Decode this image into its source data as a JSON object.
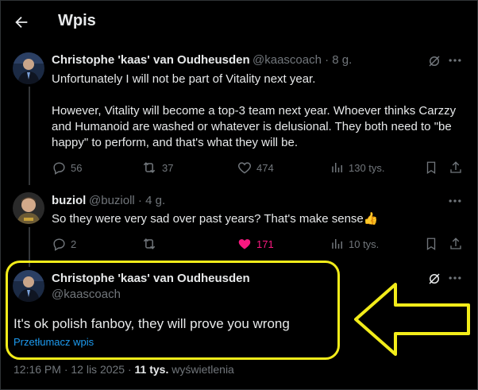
{
  "header": {
    "title": "Wpis",
    "back_icon": "back-arrow-icon"
  },
  "tweets": [
    {
      "author": "Christophe 'kaas' van Oudheusden",
      "handle": "@kaascoach",
      "time": "8 g.",
      "paragraphs": [
        "Unfortunately I will not be part of Vitality next year.",
        "However, Vitality will become a top-3 team next year. Whoever thinks Carzzy and Humanoid are washed or whatever is delusional. They both need to \"be happy\" to perform, and that's what they will be."
      ],
      "stats": {
        "replies": "56",
        "reposts": "37",
        "likes": "474",
        "views": "130 tys."
      }
    },
    {
      "author": "buziol",
      "handle": "@buzioll",
      "time": "4 g.",
      "text": "So they were very sad over past years? That's make sense",
      "emoji": "👍",
      "stats": {
        "replies": "2",
        "reposts": "",
        "likes": "171",
        "views": "10 tys."
      },
      "liked": true
    },
    {
      "author": "Christophe 'kaas' van Oudheusden",
      "handle": "@kaascoach",
      "text": "It's ok polish fanboy, they will prove you wrong",
      "translate": "Przetłumacz wpis",
      "time_full": "12:16 PM · 12 lis 2025 · ",
      "views_count": "11 tys.",
      "views_label": " wyświetlenia"
    }
  ],
  "colors": {
    "background": "#000000",
    "text": "#e7e9ea",
    "muted": "#71767b",
    "link": "#1d9bf0",
    "like": "#f91880",
    "annotation": "#f2ec1a"
  }
}
